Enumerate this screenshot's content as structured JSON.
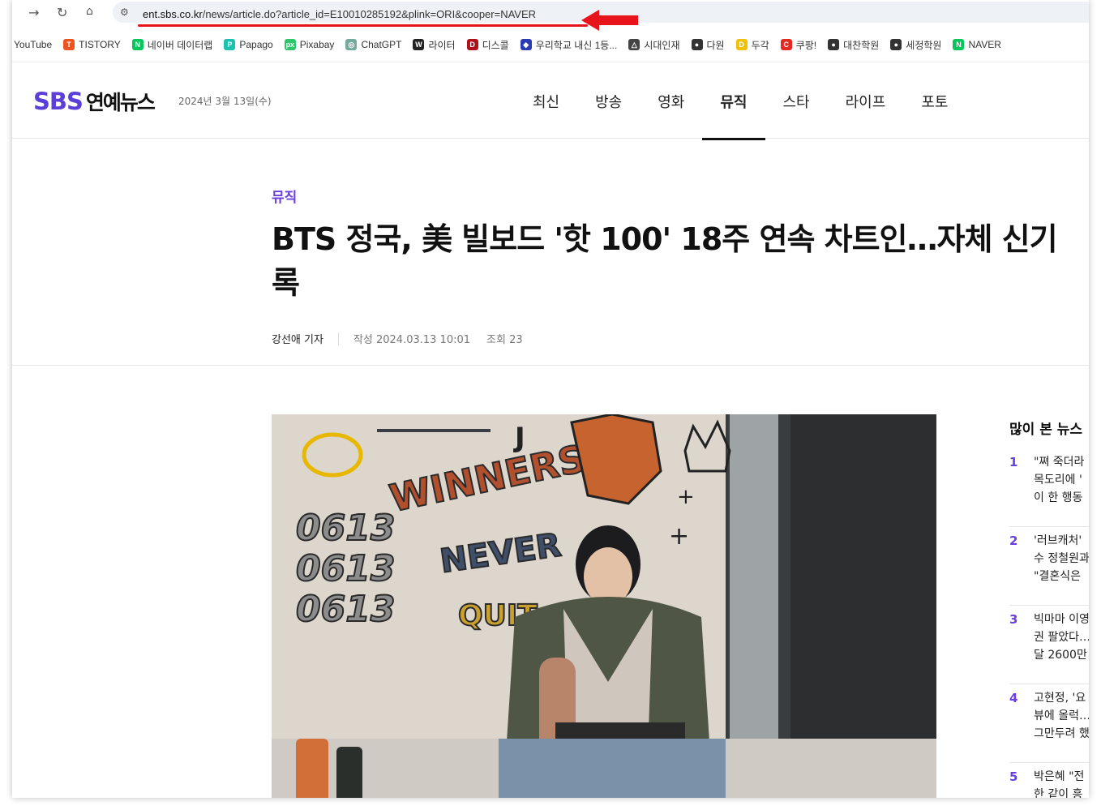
{
  "browser": {
    "url_host": "ent.sbs.co.kr",
    "url_rest": "/news/article.do?article_id=E10010285192&plink=ORI&cooper=NAVER"
  },
  "bookmarks": [
    {
      "label": "YouTube",
      "color": "",
      "glyph": ""
    },
    {
      "label": "TISTORY",
      "color": "#eb531f",
      "glyph": "T"
    },
    {
      "label": "네이버 데이터랩",
      "color": "#03c75a",
      "glyph": "N"
    },
    {
      "label": "Papago",
      "color": "#1ec1b0",
      "glyph": "P"
    },
    {
      "label": "Pixabay",
      "color": "#2ec66d",
      "glyph": "px"
    },
    {
      "label": "ChatGPT",
      "color": "#74aa9c",
      "glyph": "◎"
    },
    {
      "label": "라이터",
      "color": "#222222",
      "glyph": "W"
    },
    {
      "label": "디스콜",
      "color": "#b1101a",
      "glyph": "D"
    },
    {
      "label": "우리학교 내신 1등...",
      "color": "#2a3bb5",
      "glyph": "◆"
    },
    {
      "label": "시대인재",
      "color": "#444444",
      "glyph": "△"
    },
    {
      "label": "다원",
      "color": "#333333",
      "glyph": "●"
    },
    {
      "label": "두각",
      "color": "#f2c200",
      "glyph": "D"
    },
    {
      "label": "쿠팡!",
      "color": "#e42b23",
      "glyph": "C"
    },
    {
      "label": "대찬학원",
      "color": "#333333",
      "glyph": "●"
    },
    {
      "label": "세정학원",
      "color": "#333333",
      "glyph": "●"
    },
    {
      "label": "NAVER",
      "color": "#03c75a",
      "glyph": "N"
    }
  ],
  "site": {
    "logo_main": "SBS",
    "logo_sub": "연예뉴스",
    "date": "2024년 3월 13일(수)",
    "brand_color": "#5b3fd6"
  },
  "menu": [
    {
      "label": "최신",
      "active": false
    },
    {
      "label": "방송",
      "active": false
    },
    {
      "label": "영화",
      "active": false
    },
    {
      "label": "뮤직",
      "active": true
    },
    {
      "label": "스타",
      "active": false
    },
    {
      "label": "라이프",
      "active": false
    },
    {
      "label": "포토",
      "active": false
    }
  ],
  "article": {
    "category": "뮤직",
    "title_line1": "BTS 정국, 美 빌보드 '핫 100' 18주 연속 차트인…자체 신기",
    "title_line2": "록",
    "author": "강선애 기자",
    "written": "작성 2024.03.13 10:01",
    "views": "조회 23"
  },
  "photo_text": {
    "graffiti1": "0613",
    "graffiti2": "0613",
    "graffiti3": "0613",
    "graffiti_word1": "WINNERS",
    "graffiti_word2": "NEVER",
    "graffiti_word3": "QUIT",
    "letter": "J"
  },
  "sidebar": {
    "title": "많이 본 뉴스",
    "items": [
      {
        "num": "1",
        "lines": [
          "\"쪄 죽더라",
          "목도리에 '",
          "이 한 행동"
        ]
      },
      {
        "num": "2",
        "lines": [
          "'러브캐처'",
          "수 정철원과",
          "\"결혼식은"
        ]
      },
      {
        "num": "3",
        "lines": [
          "빅마마 이영",
          "권 팔았다…",
          "달 2600만"
        ]
      },
      {
        "num": "4",
        "lines": [
          "고현정, '요",
          "뷰에 올럭…",
          "그만두려 했"
        ]
      },
      {
        "num": "5",
        "lines": [
          "박은혜 \"전",
          "한 같이 흥"
        ]
      }
    ]
  }
}
